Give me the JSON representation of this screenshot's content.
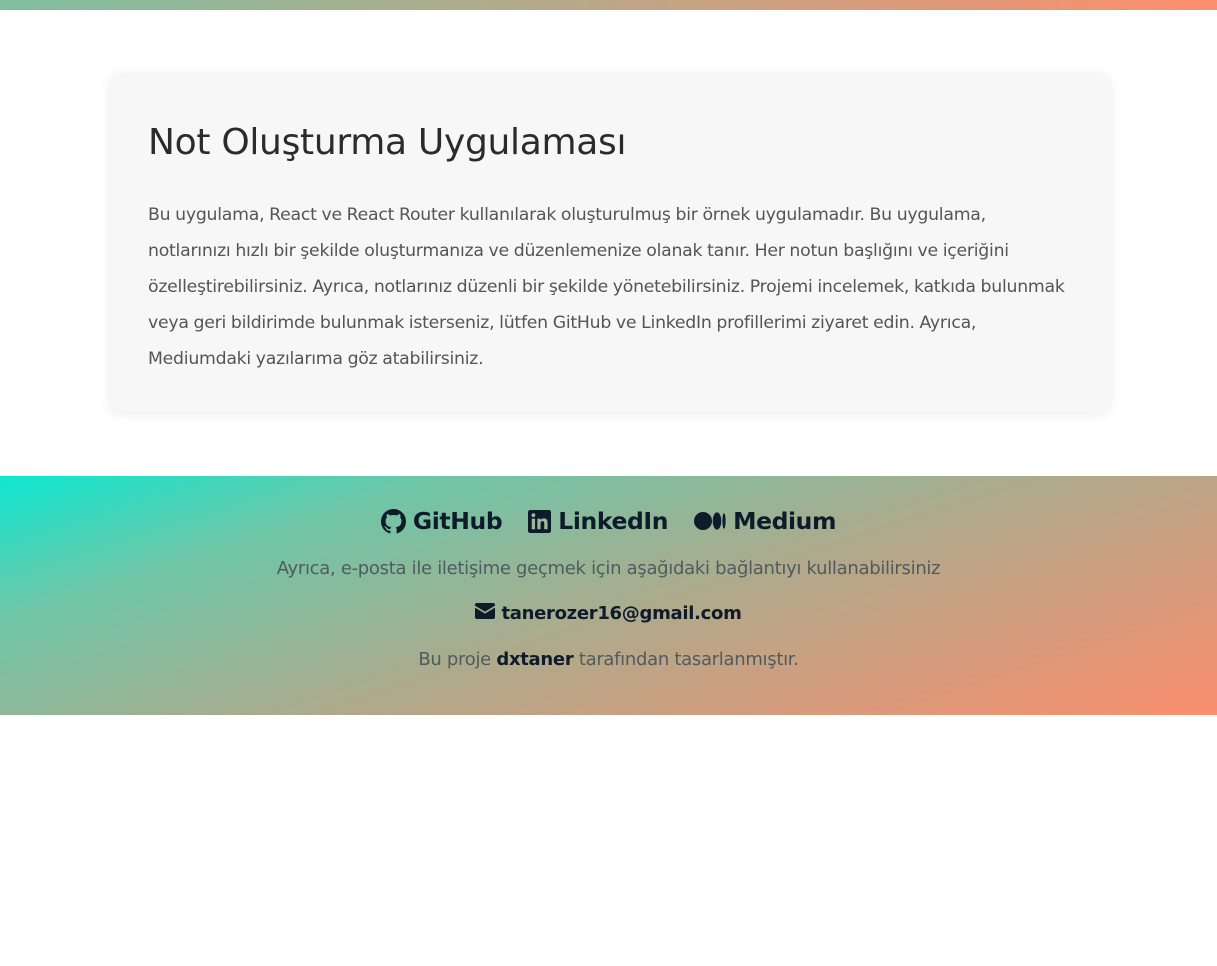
{
  "header": {
    "accent_gradient": [
      "#7fbf9f",
      "#b6a98a",
      "#fd8f6d"
    ]
  },
  "main": {
    "title": "Not Oluşturma Uygulaması",
    "description": "Bu uygulama, React ve React Router kullanılarak oluşturulmuş bir örnek uygulamadır. Bu uygulama, notlarınızı hızlı bir şekilde oluşturmanıza ve düzenlemenize olanak tanır. Her notun başlığını ve içeriğini özelleştirebilirsiniz. Ayrıca, notlarınız düzenli bir şekilde yönetebilirsiniz. Projemi incelemek, katkıda bulunmak veya geri bildirimde bulunmak isterseniz, lütfen GitHub ve LinkedIn profillerimi ziyaret edin. Ayrıca, Mediumdaki yazılarıma göz atabilirsiniz."
  },
  "footer": {
    "links": [
      {
        "label": "GitHub",
        "icon": "github-icon"
      },
      {
        "label": "LinkedIn",
        "icon": "linkedin-icon"
      },
      {
        "label": "Medium",
        "icon": "medium-icon"
      }
    ],
    "contact_text": "Ayrıca, e-posta ile iletişime geçmek için aşağıdaki bağlantıyı kullanabilirsiniz",
    "email": "tanerozer16@gmail.com",
    "email_icon": "envelope-icon",
    "credit_prefix": "Bu proje",
    "credit_author": "dxtaner",
    "credit_suffix": "tarafından tasarlanmıştır.",
    "gradient": [
      "#0ee8d2",
      "#b0a98b",
      "#fb8e6d"
    ]
  }
}
